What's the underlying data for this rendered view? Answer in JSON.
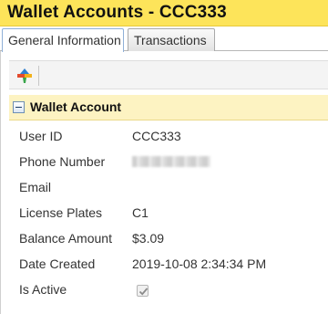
{
  "window": {
    "title": "Wallet Accounts - CCC333"
  },
  "tabs": [
    {
      "label": "General Information",
      "active": true
    },
    {
      "label": "Transactions",
      "active": false
    }
  ],
  "toolbar": {
    "primary_icon": "colorful-plus-icon"
  },
  "section": {
    "title": "Wallet Account",
    "collapse_icon": "collapse-minus-icon"
  },
  "fields": {
    "user_id": {
      "label": "User ID",
      "value": "CCC333"
    },
    "phone_number": {
      "label": "Phone Number",
      "value_state": "redacted-blurred"
    },
    "email": {
      "label": "Email",
      "value": ""
    },
    "license_plates": {
      "label": "License Plates",
      "value": "C1"
    },
    "balance_amount": {
      "label": "Balance Amount",
      "value": "$3.09"
    },
    "date_created": {
      "label": "Date Created",
      "value": "2019-10-08 2:34:34 PM"
    },
    "is_active": {
      "label": "Is Active",
      "checked": true,
      "disabled": true
    }
  },
  "colors": {
    "title_bar": "#fde45a",
    "section_header": "#fdf3c2",
    "active_tab_border": "#8fb0d8"
  }
}
